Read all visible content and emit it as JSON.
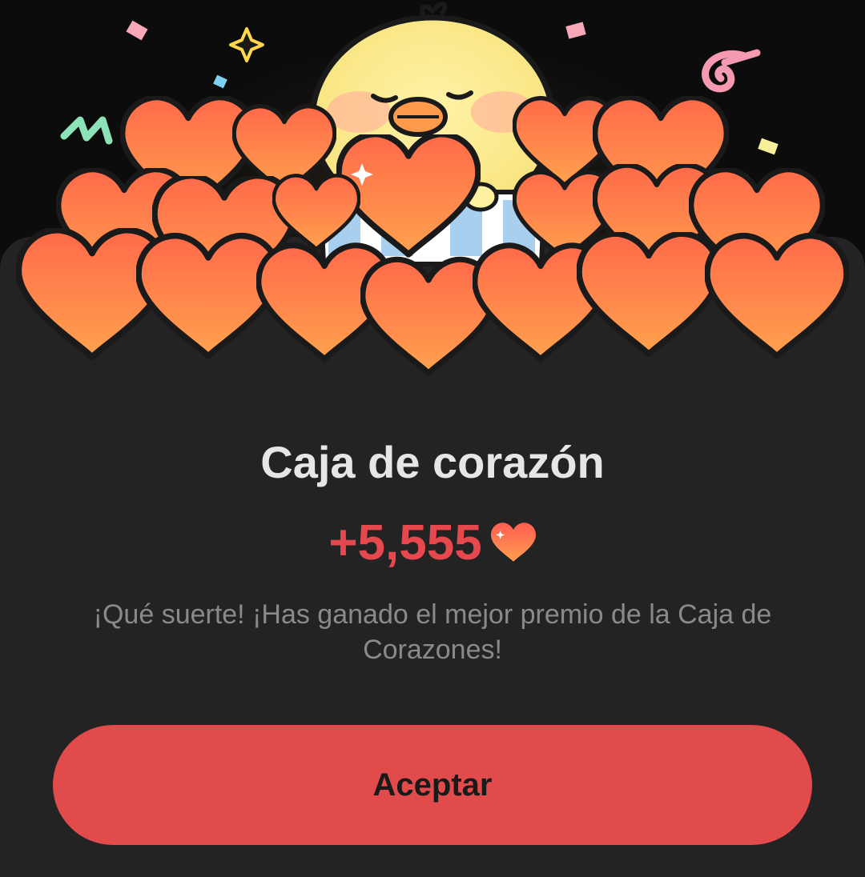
{
  "dialog": {
    "title": "Caja de corazón",
    "reward_amount": "+5,555",
    "reward_icon": "heart-icon",
    "message": "¡Qué suerte! ¡Has ganado el mejor premio de la Caja de Corazones!",
    "accept_label": "Aceptar"
  },
  "colors": {
    "background": "#0c0c0c",
    "sheet": "#232323",
    "accent": "#e14b4b",
    "reward_text": "#e5484d",
    "title_text": "#e6e6e6",
    "message_text": "#8a8a8a"
  }
}
